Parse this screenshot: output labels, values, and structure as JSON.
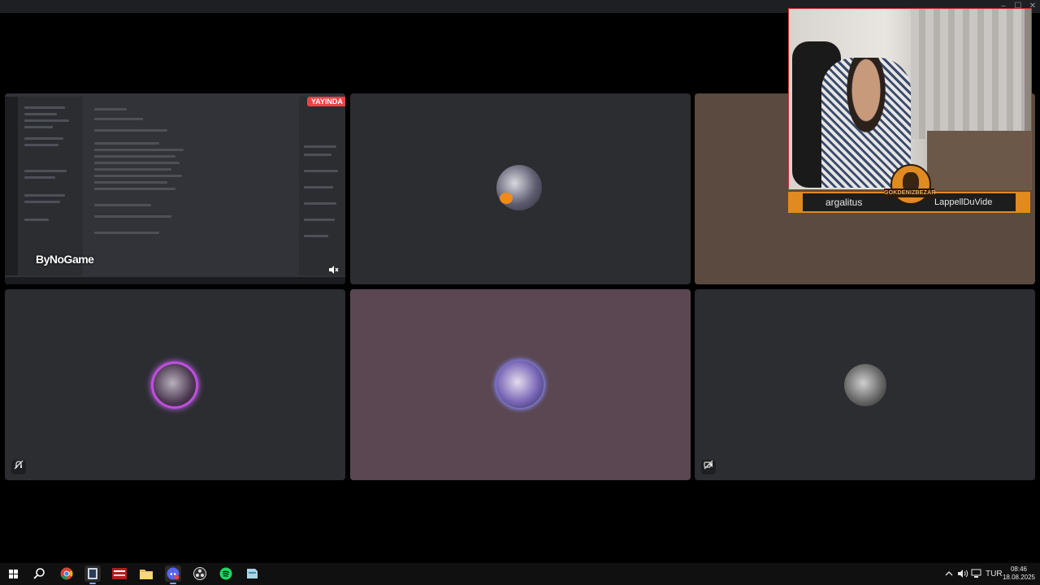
{
  "window": {
    "controls": {
      "minimize": "–",
      "maximize": "☐",
      "close": "✕"
    }
  },
  "tiles": {
    "screen_share": {
      "live_badge": "YAYINDA",
      "watermark": "ByNoGame",
      "mute_icon": "speaker-muted-icon"
    },
    "tile2": {
      "avatar_icon": "user-avatar"
    },
    "tile4": {
      "status_icon": "deafened-icon",
      "avatar_icon": "user-avatar"
    },
    "tile5": {
      "avatar_icon": "user-avatar"
    },
    "tile6": {
      "status_icon": "camera-off-icon",
      "avatar_icon": "user-avatar"
    }
  },
  "webcam_overlay": {
    "left_name": "argalitus",
    "right_name": "LappellDuVide",
    "logo_text": "GOKDENIZBEZAR",
    "accent_color": "#e08a20"
  },
  "taskbar": {
    "items": [
      {
        "name": "start-icon"
      },
      {
        "name": "search-icon"
      },
      {
        "name": "chrome-icon"
      },
      {
        "name": "app-icon"
      },
      {
        "name": "voicemeeter-icon"
      },
      {
        "name": "file-explorer-icon"
      },
      {
        "name": "discord-icon"
      },
      {
        "name": "obs-icon"
      },
      {
        "name": "spotify-icon"
      },
      {
        "name": "app-icon"
      }
    ],
    "tray": {
      "language": "TUR",
      "time": "08:46",
      "date": "18.08.2025"
    }
  }
}
